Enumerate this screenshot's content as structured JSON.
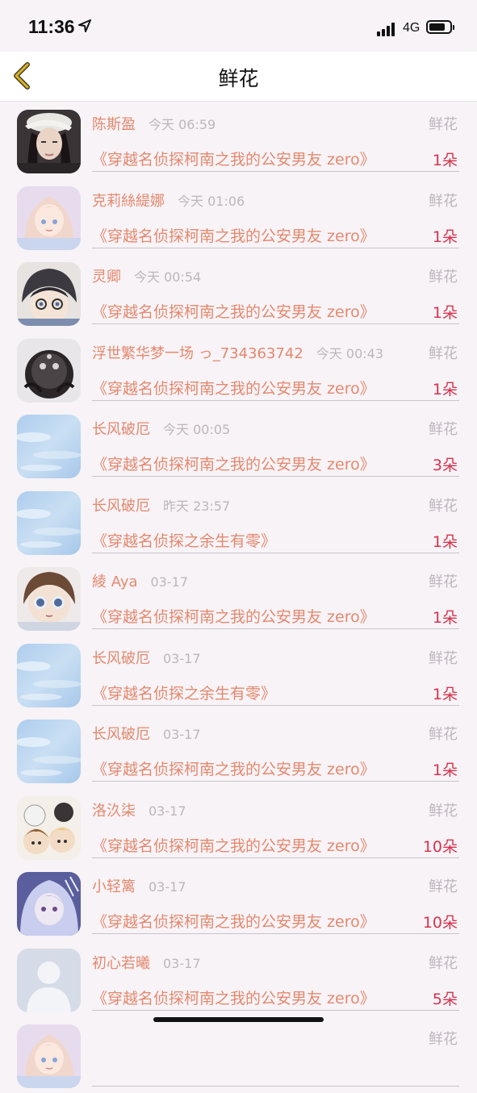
{
  "status_bar": {
    "time": "11:36",
    "network": "4G"
  },
  "nav": {
    "title": "鲜花",
    "back_icon": "chevron-left-icon",
    "accent_color": "#d7b32b"
  },
  "colors": {
    "name_text": "#e4896e",
    "meta_text": "#bdb7bd",
    "count_text": "#d8334d",
    "background": "#f7f3f7"
  },
  "list": [
    {
      "name": "陈斯盈",
      "time": "今天 06:59",
      "type": "鲜花",
      "book": "《穿越名侦探柯南之我的公安男友 zero》",
      "count": "1朵",
      "avatar": "portrait-photo"
    },
    {
      "name": "克莉絲緹娜",
      "time": "今天 01:06",
      "type": "鲜花",
      "book": "《穿越名侦探柯南之我的公安男友 zero》",
      "count": "1朵",
      "avatar": "anime-girl"
    },
    {
      "name": "灵卿",
      "time": "今天 00:54",
      "type": "鲜花",
      "book": "《穿越名侦探柯南之我的公安男友 zero》",
      "count": "1朵",
      "avatar": "anime-boy"
    },
    {
      "name": "浮世繁华梦一场 っ_734363742",
      "time": "今天 00:43",
      "type": "鲜花",
      "book": "《穿越名侦探柯南之我的公安男友 zero》",
      "count": "1朵",
      "avatar": "dark-creature"
    },
    {
      "name": "长风破厄",
      "time": "今天 00:05",
      "type": "鲜花",
      "book": "《穿越名侦探柯南之我的公安男友 zero》",
      "count": "3朵",
      "avatar": "sky"
    },
    {
      "name": "长风破厄",
      "time": "昨天 23:57",
      "type": "鲜花",
      "book": "《穿越名侦探之余生有零》",
      "count": "1朵",
      "avatar": "sky"
    },
    {
      "name": "綾 Aya",
      "time": "03-17",
      "type": "鲜花",
      "book": "《穿越名侦探柯南之我的公安男友 zero》",
      "count": "1朵",
      "avatar": "doll"
    },
    {
      "name": "长风破厄",
      "time": "03-17",
      "type": "鲜花",
      "book": "《穿越名侦探之余生有零》",
      "count": "1朵",
      "avatar": "sky"
    },
    {
      "name": "长风破厄",
      "time": "03-17",
      "type": "鲜花",
      "book": "《穿越名侦探柯南之我的公安男友 zero》",
      "count": "1朵",
      "avatar": "sky"
    },
    {
      "name": "洛汣柒",
      "time": "03-17",
      "type": "鲜花",
      "book": "《穿越名侦探柯南之我的公安男友 zero》",
      "count": "10朵",
      "avatar": "chibi-group"
    },
    {
      "name": "小轻篱",
      "time": "03-17",
      "type": "鲜花",
      "book": "《穿越名侦探柯南之我的公安男友 zero》",
      "count": "10朵",
      "avatar": "anime-blue"
    },
    {
      "name": "初心若曦",
      "time": "03-17",
      "type": "鲜花",
      "book": "《穿越名侦探柯南之我的公安男友 zero》",
      "count": "5朵",
      "avatar": "default-user"
    },
    {
      "name": "",
      "time": "",
      "type": "鲜花",
      "book": "",
      "count": "",
      "avatar": "anime-girl"
    }
  ]
}
